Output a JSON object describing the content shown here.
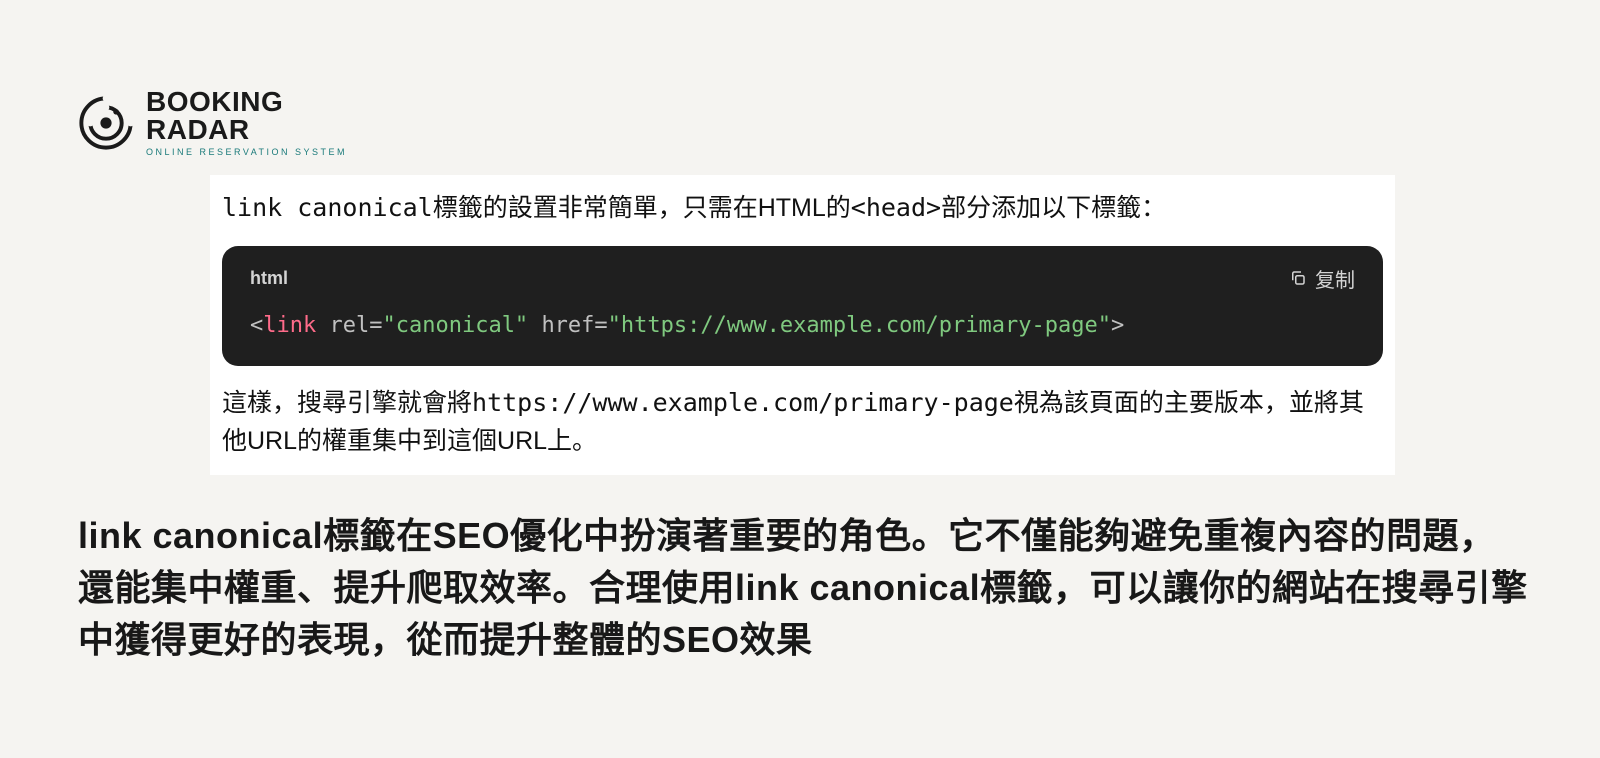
{
  "logo": {
    "line1": "BOOKING",
    "line2": "RADAR",
    "tagline": "ONLINE RESERVATION SYSTEM"
  },
  "article": {
    "intro_prefix": "link canonical",
    "intro_mid": "標籤的設置非常簡單，只需在HTML的",
    "intro_head": "<head>",
    "intro_suffix": "部分添加以下標籤：",
    "code": {
      "lang": "html",
      "copy_label": "复制",
      "bracket_open": "<",
      "tag": "link",
      "attr1": "rel",
      "val1": "\"canonical\"",
      "attr2": "href",
      "val2": "\"https://www.example.com/primary-page\"",
      "bracket_close": ">",
      "eq": "="
    },
    "outro_prefix": "這樣，搜尋引擎就會將",
    "outro_url": "https://www.example.com/primary-page",
    "outro_suffix": "視為該頁面的主要版本，並將其他URL的權重集中到這個URL上。"
  },
  "summary": "link canonical標籤在SEO優化中扮演著重要的角色。它不僅能夠避免重複內容的問題，還能集中權重、提升爬取效率。合理使用link canonical標籤，可以讓你的網站在搜尋引擎中獲得更好的表現，從而提升整體的SEO效果"
}
